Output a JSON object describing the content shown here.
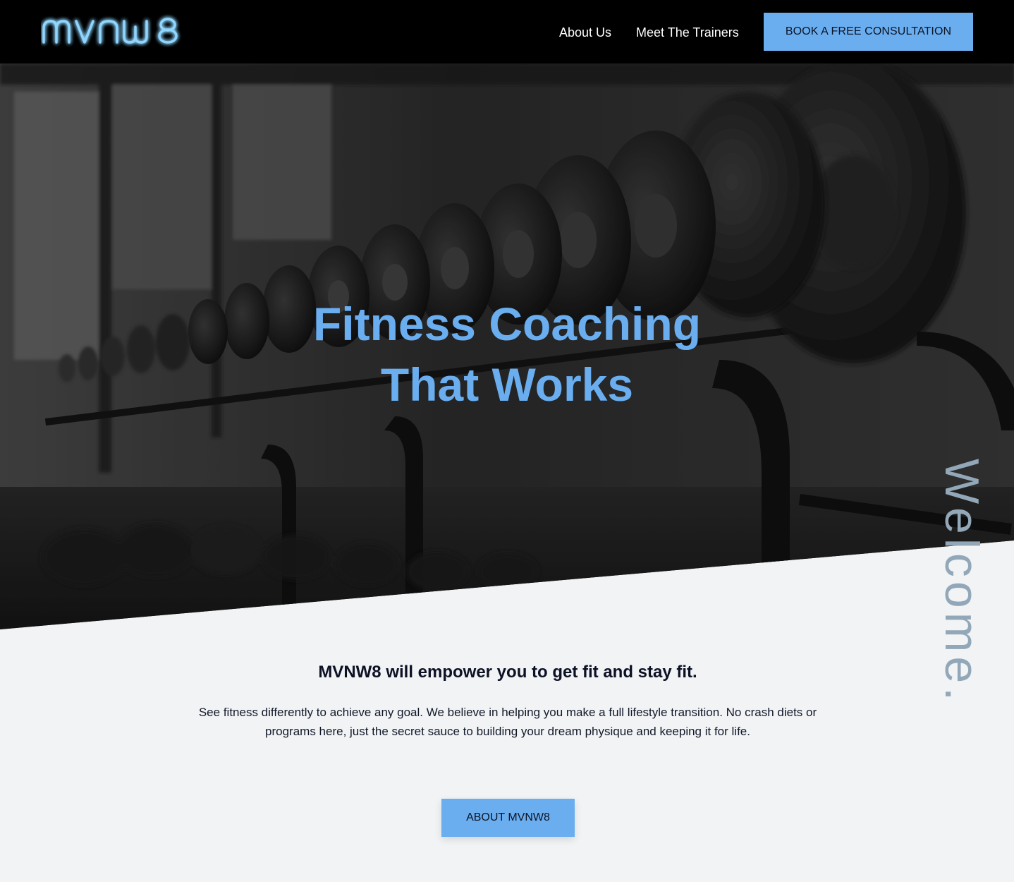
{
  "brand": {
    "logo_text": "mvnw8",
    "logo_color": "#6fc4ff"
  },
  "nav": {
    "items": [
      {
        "label": "About Us"
      },
      {
        "label": "Meet The Trainers"
      }
    ],
    "cta_label": "BOOK A FREE CONSULTATION"
  },
  "hero": {
    "title_line1": "Fitness Coaching",
    "title_line2": "That Works",
    "image": "dumbbell-rack-photo",
    "title_color": "#6aaef0"
  },
  "welcome": {
    "text": "Welcome."
  },
  "content": {
    "heading": "MVNW8 will empower you to get fit and stay fit.",
    "body": "See fitness differently to achieve any goal. We believe in helping you make a full lifestyle transition. No crash diets or programs here,  just the secret sauce to building your dream physique and keeping it for life.",
    "button_label": "ABOUT MVNW8"
  },
  "colors": {
    "accent": "#6aaef0",
    "header_bg": "#000000",
    "page_bg": "#f1f3f5",
    "welcome": "#92a7b8"
  }
}
